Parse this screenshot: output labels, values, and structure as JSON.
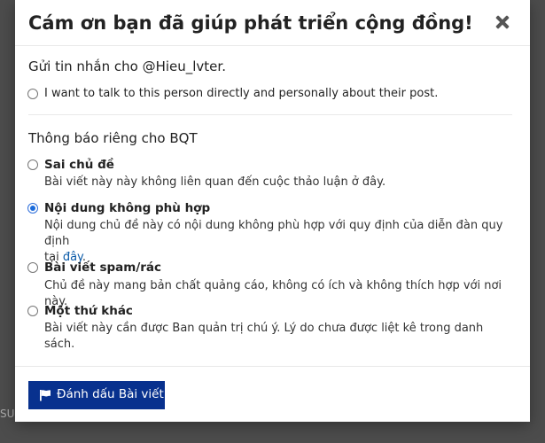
{
  "modal": {
    "title": "Cám ơn bạn đã giúp phát triển cộng đồng!"
  },
  "message_section": {
    "heading": "Gửi tin nhắn cho @Hieu_lvter.",
    "option_label": "I want to talk to this person directly and personally about their post."
  },
  "staff_section": {
    "heading": "Thông báo riêng cho BQT",
    "options": [
      {
        "title": "Sai chủ đề",
        "description": "Bài viết này này không liên quan đến cuộc thảo luận ở đây.",
        "checked": false
      },
      {
        "title": "Nội dung không phù hợp",
        "description_line1": "Nội dung chủ đề này có nội dung không phù hợp với quy định của diễn đàn quy định",
        "description_prefix": "tại ",
        "description_link": "đây",
        "description_suffix": ".",
        "checked": true
      },
      {
        "title": "Bài viết spam/rác",
        "description": "Chủ đề này mang bản chất quảng cáo, không có ích và không thích hợp với nơi này.",
        "checked": false
      },
      {
        "title": "Một thứ khác",
        "description": "Bài viết này cần được Ban quản trị chú ý. Lý do chưa được liệt kê trong danh sách.",
        "checked": false
      }
    ]
  },
  "footer": {
    "flag_button_label": "Đánh dấu Bài viết"
  },
  "background": {
    "left_fragment": "",
    "bottom_fragment": "SU"
  },
  "colors": {
    "primary_button": "#08318e",
    "radio_checked": "#1a6bdb",
    "link": "#0a5aa8",
    "backdrop": "#4c4c4c"
  }
}
